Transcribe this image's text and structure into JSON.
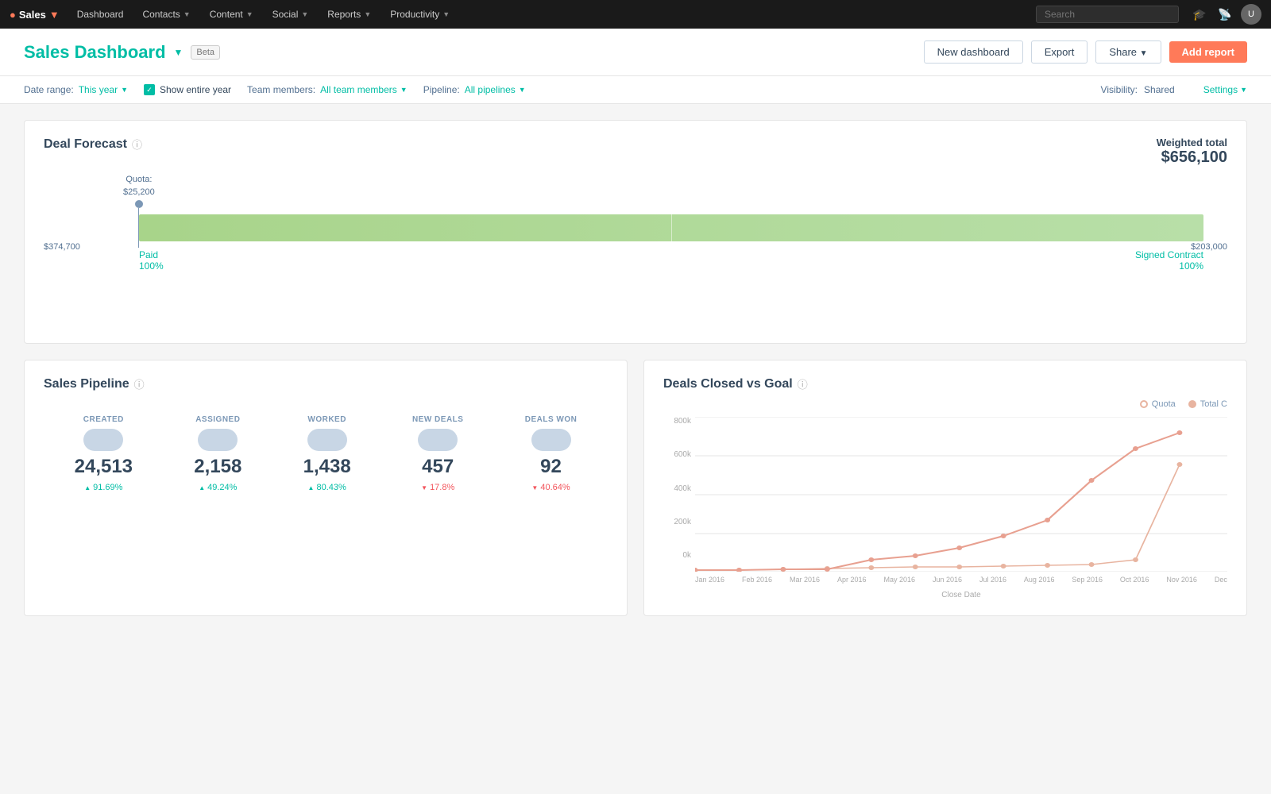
{
  "topnav": {
    "brand": "Sales",
    "nav_items": [
      "Dashboard",
      "Contacts",
      "Content",
      "Social",
      "Reports",
      "Productivity"
    ],
    "search_placeholder": "Search"
  },
  "page_header": {
    "title": "Sales Dashboard",
    "beta_label": "Beta",
    "buttons": {
      "new_dashboard": "New dashboard",
      "export": "Export",
      "share": "Share",
      "add_report": "Add report"
    }
  },
  "filter_bar": {
    "date_range_label": "Date range:",
    "date_range_value": "This year",
    "show_entire_year": "Show entire year",
    "team_members_label": "Team members:",
    "team_members_value": "All team members",
    "pipeline_label": "Pipeline:",
    "pipeline_value": "All pipelines",
    "visibility_label": "Visibility:",
    "visibility_value": "Shared",
    "settings_label": "Settings"
  },
  "deal_forecast": {
    "title": "Deal Forecast",
    "weighted_label": "Weighted total",
    "weighted_value": "$656,100",
    "quota_label": "Quota:",
    "quota_value": "$25,200",
    "bar_left_value": "$374,700",
    "bar_right_value": "$203,000",
    "annotation_left_label": "Paid",
    "annotation_left_pct": "100%",
    "annotation_right_label": "Signed Contract",
    "annotation_right_pct": "100%"
  },
  "sales_pipeline": {
    "title": "Sales Pipeline",
    "stats": [
      {
        "label": "CREATED",
        "value": "24,513",
        "change": "91.69%",
        "direction": "up"
      },
      {
        "label": "ASSIGNED",
        "value": "2,158",
        "change": "49.24%",
        "direction": "up"
      },
      {
        "label": "WORKED",
        "value": "1,438",
        "change": "80.43%",
        "direction": "up"
      },
      {
        "label": "NEW DEALS",
        "value": "457",
        "change": "17.8%",
        "direction": "down"
      },
      {
        "label": "DEALS WON",
        "value": "92",
        "change": "40.64%",
        "direction": "down"
      }
    ]
  },
  "deals_closed": {
    "title": "Deals Closed vs Goal",
    "legend": {
      "quota": "Quota",
      "total": "Total C"
    },
    "y_labels": [
      "0k",
      "200k",
      "400k",
      "600k",
      "800k"
    ],
    "x_labels": [
      "Jan 2016",
      "Feb 2016",
      "Mar 2016",
      "Apr 2016",
      "May 2016",
      "Jun 2016",
      "Jul 2016",
      "Aug 2016",
      "Sep 2016",
      "Oct 2016",
      "Nov 2016",
      "Dec"
    ],
    "close_date": "Close Date"
  }
}
